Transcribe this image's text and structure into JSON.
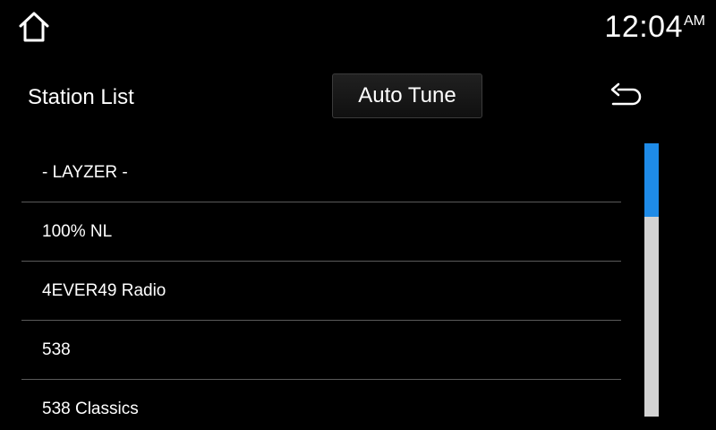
{
  "header": {
    "home_icon": "home-icon",
    "clock": {
      "time": "12:04",
      "ampm": "AM"
    }
  },
  "toolbar": {
    "title": "Station List",
    "auto_tune_label": "Auto Tune",
    "back_icon": "back-arrow-icon"
  },
  "stations": [
    "- LAYZER -",
    "100% NL",
    "4EVER49 Radio",
    "538",
    "538 Classics"
  ],
  "scrollbar": {
    "position_fraction": 0.27
  },
  "colors": {
    "background": "#000000",
    "text": "#ffffff",
    "divider": "#5a5a5a",
    "scroll_track": "#d3d3d3",
    "scroll_thumb": "#1e8be8"
  }
}
